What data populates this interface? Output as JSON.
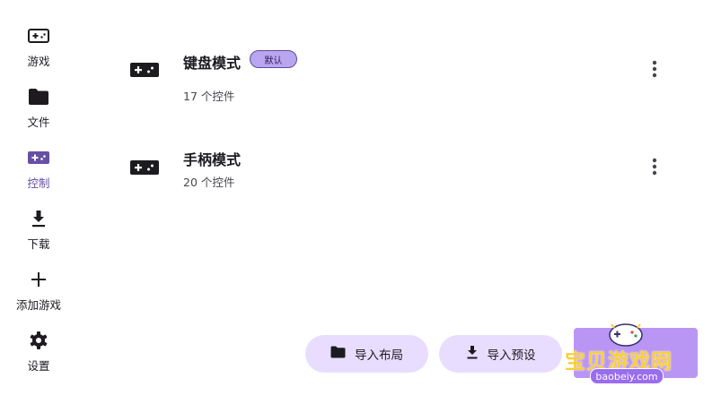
{
  "sidebar": {
    "items": [
      {
        "label": "游戏",
        "icon": "gamepad-icon"
      },
      {
        "label": "文件",
        "icon": "folder-icon"
      },
      {
        "label": "控制",
        "icon": "gamepad-icon",
        "active": true
      },
      {
        "label": "下载",
        "icon": "download-icon"
      },
      {
        "label": "添加游戏",
        "icon": "plus-icon"
      },
      {
        "label": "设置",
        "icon": "gear-icon"
      }
    ]
  },
  "layouts": [
    {
      "name": "键盘模式",
      "count": "17 个控件",
      "badge": "默认",
      "icon": "gamepad-icon"
    },
    {
      "name": "手柄模式",
      "count": "20 个控件",
      "icon": "gamepad-icon"
    }
  ],
  "actions": {
    "import_layout": "导入布局",
    "import_preset": "导入预设"
  },
  "watermark": {
    "text": "宝贝游戏网",
    "url": "baobeiy.com"
  },
  "colors": {
    "accent": "#6750a4",
    "button_bg": "#e9ddff",
    "badge_bg": "#b9a6f1"
  }
}
